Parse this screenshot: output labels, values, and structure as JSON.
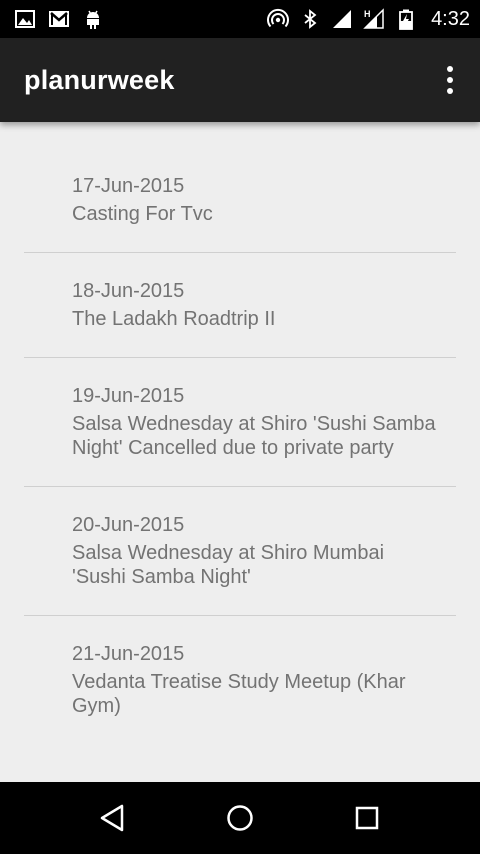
{
  "status_bar": {
    "time": "4:32",
    "left_icons": [
      "image-icon",
      "gmail-icon",
      "android-icon"
    ],
    "right_icons": [
      "hotspot-icon",
      "bluetooth-icon",
      "signal-icon",
      "signal-h-icon",
      "battery-charging-icon"
    ]
  },
  "app_bar": {
    "title": "planurweek",
    "menu_icon": "overflow-menu-icon"
  },
  "events": [
    {
      "date": "17-Jun-2015",
      "title": "Casting For Tvc"
    },
    {
      "date": "18-Jun-2015",
      "title": "The Ladakh Roadtrip II"
    },
    {
      "date": "19-Jun-2015",
      "title": "Salsa Wednesday at Shiro 'Sushi Samba Night' Cancelled due to private party"
    },
    {
      "date": "20-Jun-2015",
      "title": "Salsa Wednesday at Shiro Mumbai 'Sushi Samba Night'"
    },
    {
      "date": "21-Jun-2015",
      "title": "Vedanta Treatise Study Meetup (Khar Gym)"
    }
  ],
  "nav_bar": {
    "icons": [
      "back-icon",
      "home-icon",
      "recents-icon"
    ]
  },
  "colors": {
    "status_bar": "#000000",
    "app_bar": "#212121",
    "background": "#eeeeee",
    "text": "#737373",
    "divider": "#cfcfcf"
  }
}
